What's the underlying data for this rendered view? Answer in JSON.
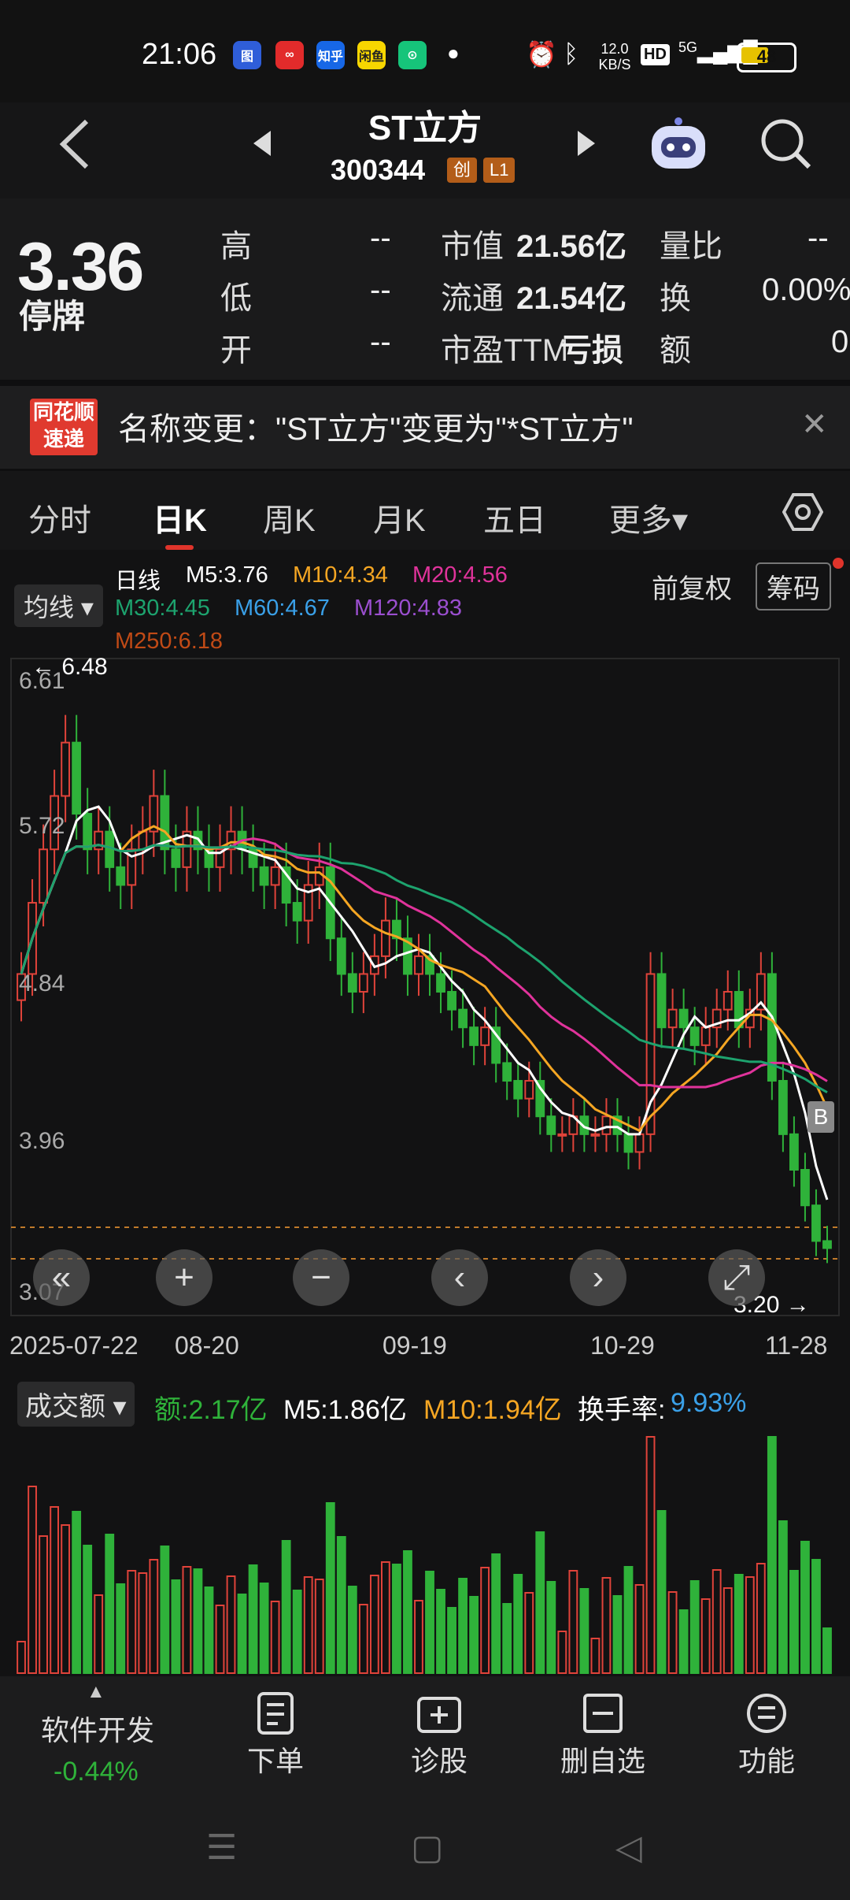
{
  "status_bar": {
    "time": "21:06",
    "app_icons": [
      {
        "name": "baidu-map-icon",
        "color": "#2f5ed9",
        "label": "图"
      },
      {
        "name": "huawei-icon",
        "color": "#e22b2b",
        "label": "∞"
      },
      {
        "name": "zhihu-icon",
        "color": "#1767e6",
        "label": "知乎"
      },
      {
        "name": "xianyu-icon",
        "color": "#f7d600",
        "label": "闲鱼"
      },
      {
        "name": "wechat-mini-icon",
        "color": "#16c47a",
        "label": "⊙"
      }
    ],
    "net_speed": "12.0 KB/S",
    "hd": "HD",
    "signal": "5G",
    "battery": "48"
  },
  "header": {
    "title": "ST立方",
    "code": "300344",
    "tag_chuang": "创",
    "tag_level": "L1"
  },
  "quote": {
    "price": "3.36",
    "status": "停牌",
    "rows": [
      {
        "label1": "高",
        "value1": "--",
        "label2": "市值",
        "value2": "21.56亿",
        "label3": "量比",
        "value3": "--"
      },
      {
        "label1": "低",
        "value1": "--",
        "label2": "流通",
        "value2": "21.54亿",
        "label3": "换",
        "value3": "0.00%"
      },
      {
        "label1": "开",
        "value1": "--",
        "label2": "市盈TTM",
        "value2": "亏损",
        "label3": "额",
        "value3": "0"
      }
    ]
  },
  "news": {
    "logo_top": "同花顺",
    "logo_bottom": "速递",
    "text": "名称变更：\"ST立方\"变更为\"*ST立方\""
  },
  "tabs": [
    "分时",
    "日K",
    "周K",
    "月K",
    "五日",
    "更多▾"
  ],
  "chart_header": {
    "ma_button": "均线 ▾",
    "period": "日线",
    "m5": "M5:3.76",
    "m10": "M10:4.34",
    "m20": "M20:4.56",
    "m30": "M30:4.45",
    "m60": "M60:4.67",
    "m120": "M120:4.83",
    "m250": "M250:6.18",
    "adjust": "前复权",
    "chips": "筹码",
    "colors": {
      "m5": "#ffffff",
      "m10": "#f5a623",
      "m20": "#e0339b",
      "m30": "#1da36e",
      "m60": "#3aa0e8",
      "m120": "#9b4fd0",
      "m250": "#c04a16",
      "up": "#e0433a",
      "down": "#2fb23a"
    }
  },
  "chart_data": {
    "type": "candlestick",
    "price_axis_labels": [
      "6.61",
      "5.72",
      "4.84",
      "3.96",
      "3.07"
    ],
    "max_label": "6.48",
    "min_label": "3.20",
    "x_labels": [
      "2025-07-22",
      "08-20",
      "09-19",
      "10-29",
      "11-28"
    ],
    "marker": "B",
    "ohlc_closes": [
      4.9,
      5.3,
      5.6,
      5.9,
      6.2,
      5.8,
      5.6,
      5.7,
      5.5,
      5.4,
      5.6,
      5.7,
      5.9,
      5.6,
      5.5,
      5.7,
      5.6,
      5.5,
      5.6,
      5.7,
      5.6,
      5.5,
      5.4,
      5.5,
      5.3,
      5.2,
      5.4,
      5.5,
      5.1,
      4.9,
      4.8,
      4.9,
      5.0,
      5.2,
      5.1,
      4.9,
      5.0,
      4.9,
      4.8,
      4.7,
      4.6,
      4.5,
      4.6,
      4.4,
      4.3,
      4.2,
      4.3,
      4.1,
      4.0,
      4.0,
      4.1,
      4.0,
      4.0,
      4.1,
      4.0,
      3.9,
      4.0,
      4.9,
      4.6,
      4.7,
      4.6,
      4.5,
      4.6,
      4.7,
      4.8,
      4.6,
      4.7,
      4.9,
      4.3,
      4.0,
      3.8,
      3.6,
      3.4,
      3.36
    ]
  },
  "volume_header": {
    "selector": "成交额 ▾",
    "amount": "额:2.17亿",
    "m5": "M5:1.86亿",
    "m10": "M10:1.94亿",
    "turnover_label": "换手率:",
    "turnover_value": "9.93%"
  },
  "bottom_nav": {
    "sector_arrow": "▲",
    "sector_name": "软件开发",
    "sector_change": "-0.44%",
    "items": [
      "下单",
      "诊股",
      "删自选",
      "功能"
    ]
  }
}
